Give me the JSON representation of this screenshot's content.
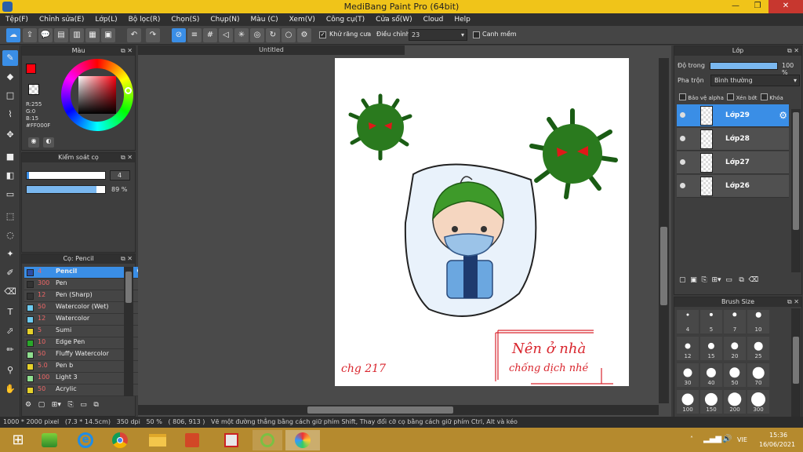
{
  "window": {
    "title": "MediBang Paint Pro (64bit)",
    "min": "—",
    "max": "❐",
    "close": "✕"
  },
  "menu": [
    "Tệp(F)",
    "Chỉnh sửa(E)",
    "Lớp(L)",
    "Bộ lọc(R)",
    "Chọn(S)",
    "Chụp(N)",
    "Màu (C)",
    "Xem(V)",
    "Công cụ(T)",
    "Cửa sổ(W)",
    "Cloud",
    "Help"
  ],
  "toolbar": {
    "antialias_label": "Khử răng cưa",
    "adjust_label": "Điều chỉnh",
    "adjust_value": "23",
    "margin_label": "Canh mềm"
  },
  "color_panel": {
    "title": "Màu",
    "r": "R:255",
    "g": "G:0",
    "b": "B:15",
    "hex": "#FF000F",
    "primary_color": "#ff000f",
    "accent": "#3a8ee6"
  },
  "brush_control": {
    "title": "Kiểm soát cọ",
    "size": "4",
    "opacity": "89 %",
    "opacity_value": 0.89
  },
  "brush_panel": {
    "title": "Cọ: Pencil",
    "brushes": [
      {
        "size": "4",
        "name": "Pencil",
        "color": "#2a4fa8",
        "selected": true
      },
      {
        "size": "300",
        "name": "Pen",
        "color": "#333333"
      },
      {
        "size": "12",
        "name": "Pen (Sharp)",
        "color": "#333333"
      },
      {
        "size": "50",
        "name": "Watercolor (Wet)",
        "color": "#6ccaf0"
      },
      {
        "size": "12",
        "name": "Watercolor",
        "color": "#6ccaf0"
      },
      {
        "size": "5",
        "name": "Sumi",
        "color": "#e6d12a"
      },
      {
        "size": "10",
        "name": "Edge Pen",
        "color": "#2aa82a"
      },
      {
        "size": "50",
        "name": "Fluffy Watercolor",
        "color": "#8fe08f"
      },
      {
        "size": "5.0",
        "name": "Pen b",
        "color": "#e6d12a"
      },
      {
        "size": "100",
        "name": "Light 3",
        "color": "#8fe08f"
      },
      {
        "size": "50",
        "name": "Acrylic",
        "color": "#e6d12a"
      }
    ]
  },
  "document": {
    "tab_title": "Untitled"
  },
  "artwork": {
    "signature": "chg 217",
    "note_line1": "Nên ở nhà",
    "note_line2": "chống dịch nhé"
  },
  "layer_panel": {
    "title": "Lớp",
    "opacity_label": "Độ trong",
    "opacity_value": "100 %",
    "opacity_fraction": 1.0,
    "blend_label": "Pha trộn",
    "blend_value": "Bình thường",
    "protect_alpha": "Bảo vệ alpha",
    "clipping": "Xén bớt",
    "lock": "Khóa",
    "layers": [
      {
        "name": "Lớp29",
        "selected": true
      },
      {
        "name": "Lớp28"
      },
      {
        "name": "Lớp27"
      },
      {
        "name": "Lớp26"
      }
    ]
  },
  "brush_size_panel": {
    "title": "Brush Size",
    "sizes": [
      "4",
      "5",
      "7",
      "10",
      "12",
      "15",
      "20",
      "25",
      "30",
      "40",
      "50",
      "70",
      "100",
      "150",
      "200",
      "300"
    ]
  },
  "status": {
    "dimensions": "1000 * 2000 pixel",
    "physical": "(7.3 * 14.5cm)",
    "dpi": "350 dpi",
    "zoom": "50 %",
    "cursor": "( 806, 913 )",
    "hint": "Vẽ một đường thẳng bằng cách giữ phím Shift, Thay đổi cỡ cọ bằng cách giữ phím Ctrl, Alt và kéo"
  },
  "taskbar": {
    "lang": "VIE",
    "time": "15:36",
    "date": "16/06/2021"
  }
}
